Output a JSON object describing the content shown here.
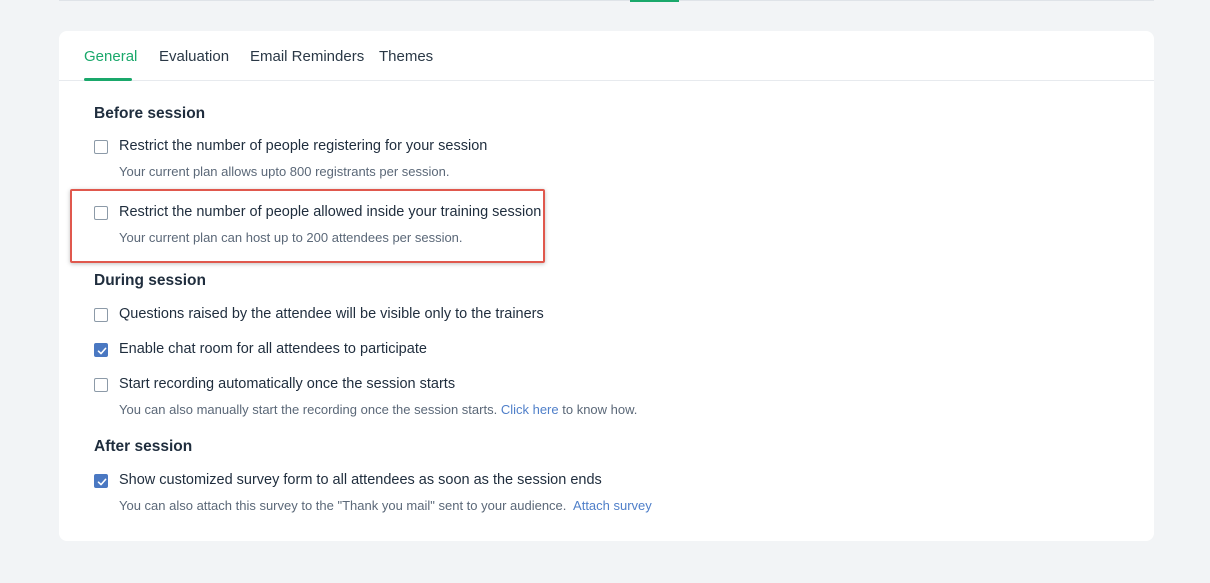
{
  "tabs": [
    {
      "label": "General",
      "active": true
    },
    {
      "label": "Evaluation",
      "active": false
    },
    {
      "label": "Email Reminders",
      "active": false
    },
    {
      "label": "Themes",
      "active": false
    }
  ],
  "sections": {
    "before": {
      "title": "Before session",
      "options": [
        {
          "label": "Restrict the number of people registering for your session",
          "checked": false,
          "help": "Your current plan allows upto 800 registrants per session."
        },
        {
          "label": "Restrict the number of people allowed inside your training session",
          "checked": false,
          "help": "Your current plan can host up to 200 attendees per session."
        }
      ]
    },
    "during": {
      "title": "During session",
      "options": [
        {
          "label": "Questions raised by the attendee will be visible only to the trainers",
          "checked": false
        },
        {
          "label": "Enable chat room for all attendees to participate",
          "checked": true
        },
        {
          "label": "Start recording automatically once the session starts",
          "checked": false,
          "help_prefix": "You can also manually start the recording once the session starts.",
          "help_link": "Click here",
          "help_suffix": "to know how."
        }
      ]
    },
    "after": {
      "title": "After session",
      "options": [
        {
          "label": "Show customized survey form to all attendees as soon as the session ends",
          "checked": true,
          "help_prefix": "You can also attach this survey to the \"Thank you mail\" sent to your audience.",
          "help_link": "Attach survey"
        }
      ]
    }
  },
  "colors": {
    "accent": "#1aa86b",
    "checkbox_checked": "#4a78c2",
    "link": "#4f7fc9",
    "highlight_border": "#e0584d"
  }
}
